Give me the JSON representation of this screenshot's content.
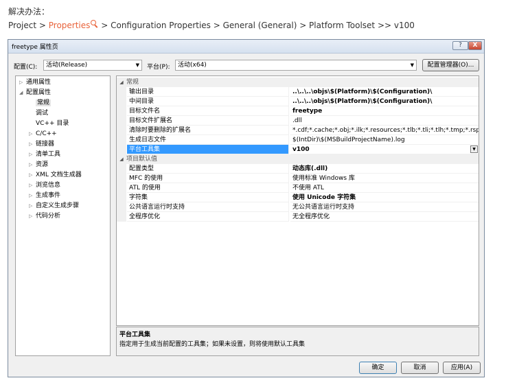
{
  "article": {
    "intro": "解决办法：",
    "path": {
      "project": "Project",
      "sep1": " > ",
      "properties": "Properties",
      "search_icon": "search-icon",
      "sep2": " > ",
      "rest": "Configuration Properties > General (General) > Platform Toolset >> v100"
    }
  },
  "dialog": {
    "title": "freetype 属性页",
    "help_label": "?",
    "close_label": "X",
    "config_label": "配置(C):",
    "config_value": "活动(Release)",
    "platform_label": "平台(P):",
    "platform_value": "活动(x64)",
    "config_manager_label": "配置管理器(O)...",
    "ok_label": "确定",
    "cancel_label": "取消",
    "apply_label": "应用(A)"
  },
  "tree": {
    "items": [
      {
        "label": "通用属性",
        "glyph": "▷"
      },
      {
        "label": "配置属性",
        "glyph": "◢"
      },
      {
        "label": "常规",
        "glyph": ""
      },
      {
        "label": "调试",
        "glyph": ""
      },
      {
        "label": "VC++ 目录",
        "glyph": ""
      },
      {
        "label": "C/C++",
        "glyph": "▷"
      },
      {
        "label": "链接器",
        "glyph": "▷"
      },
      {
        "label": "清单工具",
        "glyph": "▷"
      },
      {
        "label": "资源",
        "glyph": "▷"
      },
      {
        "label": "XML 文档生成器",
        "glyph": "▷"
      },
      {
        "label": "浏览信息",
        "glyph": "▷"
      },
      {
        "label": "生成事件",
        "glyph": "▷"
      },
      {
        "label": "自定义生成步骤",
        "glyph": "▷"
      },
      {
        "label": "代码分析",
        "glyph": "▷"
      }
    ]
  },
  "grid": {
    "cat_general": "常规",
    "cat_defaults": "项目默认值",
    "general_rows": [
      {
        "name": "输出目录",
        "value": "..\\..\\..\\objs\\$(Platform)\\$(Configuration)\\"
      },
      {
        "name": "中间目录",
        "value": "..\\..\\..\\objs\\$(Platform)\\$(Configuration)\\"
      },
      {
        "name": "目标文件名",
        "value": "freetype"
      },
      {
        "name": "目标文件扩展名",
        "value": ".dll"
      },
      {
        "name": "清除时要删除的扩展名",
        "value": "*.cdf;*.cache;*.obj;*.ilk;*.resources;*.tlb;*.tli;*.tlh;*.tmp;*.rsp;*.pgc"
      },
      {
        "name": "生成日志文件",
        "value": "$(IntDir)\\$(MSBuildProjectName).log"
      },
      {
        "name": "平台工具集",
        "value": "v100"
      }
    ],
    "default_rows": [
      {
        "name": "配置类型",
        "value": "动态库(.dll)"
      },
      {
        "name": "MFC 的使用",
        "value": "使用标准 Windows 库"
      },
      {
        "name": "ATL 的使用",
        "value": "不使用 ATL"
      },
      {
        "name": "字符集",
        "value": "使用 Unicode 字符集"
      },
      {
        "name": "公共语言运行时支持",
        "value": "无公共语言运行时支持"
      },
      {
        "name": "全程序优化",
        "value": "无全程序优化"
      }
    ]
  },
  "description": {
    "title": "平台工具集",
    "text": "指定用于生成当前配置的工具集；如果未设置，则将使用默认工具集"
  }
}
